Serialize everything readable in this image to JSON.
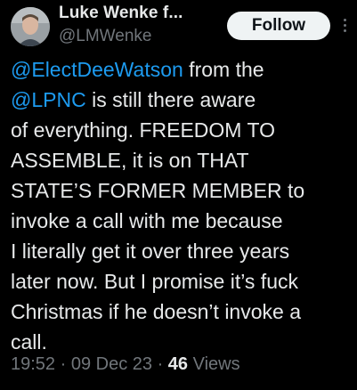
{
  "author": {
    "display_name": "Luke Wenke f...",
    "handle": "@LMWenke"
  },
  "follow_label": "Follow",
  "tweet": {
    "line1": "@ElectDeeWatson from the",
    "line2_link": "@LPNC",
    "line2_rest": " is still there aware",
    "line3": "of everything.  FREEDOM TO",
    "line4": "ASSEMBLE, it is on THAT",
    "line5": "STATE’S FORMER MEMBER to",
    "line6": "invoke a call with me because",
    "line7": "I literally get it over three years",
    "line8": "later now.  But I promise it’s fuck",
    "line9": "Christmas if he doesn’t invoke a",
    "line10": "call."
  },
  "meta": {
    "time": "19:52",
    "date": "09 Dec 23",
    "views_count": "46",
    "views_label": "Views"
  },
  "colors": {
    "background": "#000000",
    "text": "#e7e9ea",
    "secondary": "#71767b",
    "link": "#1d9bf0",
    "button_bg": "#eff3f4"
  }
}
